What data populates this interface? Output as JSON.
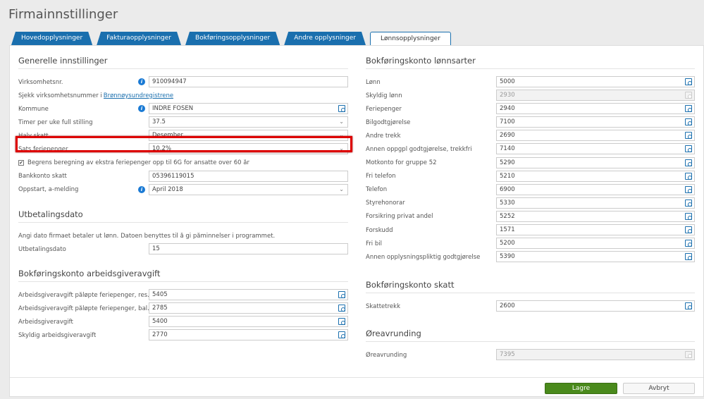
{
  "title": "Firmainnstillinger",
  "tabs": [
    "Hovedopplysninger",
    "Fakturaopplysninger",
    "Bokføringsopplysninger",
    "Andre opplysninger",
    "Lønnsopplysninger"
  ],
  "general": {
    "heading": "Generelle innstillinger",
    "virksomhetsnr_label": "Virksomhetsnr.",
    "virksomhetsnr": "910094947",
    "check_text": "Sjekk virksomhetsnummer i ",
    "check_link": "Brønnøysundregistrene",
    "kommune_label": "Kommune",
    "kommune": "INDRE FOSEN",
    "timer_label": "Timer per uke full stilling",
    "timer": "37.5",
    "halv_label": "Halv skatt",
    "halv": "Desember",
    "sats_label": "Sats feriepenger",
    "sats": "10.2%",
    "begrens_label": "Begrens beregning av ekstra feriepenger opp til 6G for ansatte over 60 år",
    "begrens_checked": true,
    "bank_label": "Bankkonto skatt",
    "bank": "05396119015",
    "oppstart_label": "Oppstart, a-melding",
    "oppstart": "April 2018"
  },
  "utbetaling": {
    "heading": "Utbetalingsdato",
    "desc": "Angi dato firmaet betaler ut lønn. Datoen benyttes til å gi påminnelser i programmet.",
    "label": "Utbetalingsdato",
    "value": "15"
  },
  "aga": {
    "heading": "Bokføringskonto arbeidsgiveravgift",
    "rows": [
      {
        "label": "Arbeidsgiveravgift påløpte feriepenger, res...",
        "value": "5405"
      },
      {
        "label": "Arbeidsgiveravgift påløpte feriepenger, bal...",
        "value": "2785"
      },
      {
        "label": "Arbeidsgiveravgift",
        "value": "5400"
      },
      {
        "label": "Skyldig arbeidsgiveravgift",
        "value": "2770"
      }
    ]
  },
  "lonnsarter": {
    "heading": "Bokføringskonto lønnsarter",
    "rows": [
      {
        "label": "Lønn",
        "value": "5000"
      },
      {
        "label": "Skyldig lønn",
        "value": "2930",
        "disabled": true
      },
      {
        "label": "Feriepenger",
        "value": "2940"
      },
      {
        "label": "Bilgodtgjørelse",
        "value": "7100"
      },
      {
        "label": "Andre trekk",
        "value": "2690"
      },
      {
        "label": "Annen oppgpl godtgjørelse, trekkfri",
        "value": "7140"
      },
      {
        "label": "Motkonto for gruppe 52",
        "value": "5290"
      },
      {
        "label": "Fri telefon",
        "value": "5210"
      },
      {
        "label": "Telefon",
        "value": "6900"
      },
      {
        "label": "Styrehonorar",
        "value": "5330"
      },
      {
        "label": "Forsikring privat andel",
        "value": "5252"
      },
      {
        "label": "Forskudd",
        "value": "1571"
      },
      {
        "label": "Fri bil",
        "value": "5200"
      },
      {
        "label": "Annen opplysningspliktig godtgjørelse",
        "value": "5390"
      }
    ]
  },
  "skatt": {
    "heading": "Bokføringskonto skatt",
    "rows": [
      {
        "label": "Skattetrekk",
        "value": "2600"
      }
    ]
  },
  "ore": {
    "heading": "Øreavrunding",
    "rows": [
      {
        "label": "Øreavrunding",
        "value": "7395",
        "disabled": true
      }
    ]
  },
  "buttons": {
    "save": "Lagre",
    "cancel": "Avbryt"
  }
}
